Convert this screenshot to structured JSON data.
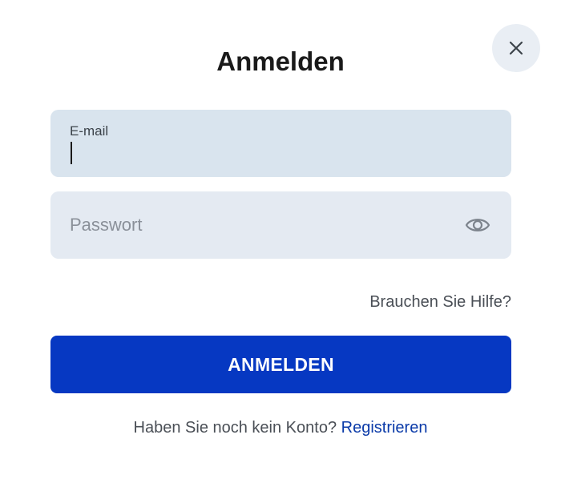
{
  "dialog": {
    "title": "Anmelden",
    "close_icon": "close-icon"
  },
  "email": {
    "label": "E-mail",
    "value": ""
  },
  "password": {
    "placeholder": "Passwort",
    "value": "",
    "toggle_icon": "eye-icon"
  },
  "help": {
    "label": "Brauchen Sie Hilfe?"
  },
  "submit": {
    "label": "ANMELDEN"
  },
  "signup": {
    "prompt": "Haben Sie noch kein Konto?",
    "link_label": "Registrieren"
  },
  "colors": {
    "primary": "#0638c2",
    "email_field_bg": "#d9e4ee",
    "password_field_bg": "#e4eaf2",
    "link": "#0a3aa8"
  }
}
